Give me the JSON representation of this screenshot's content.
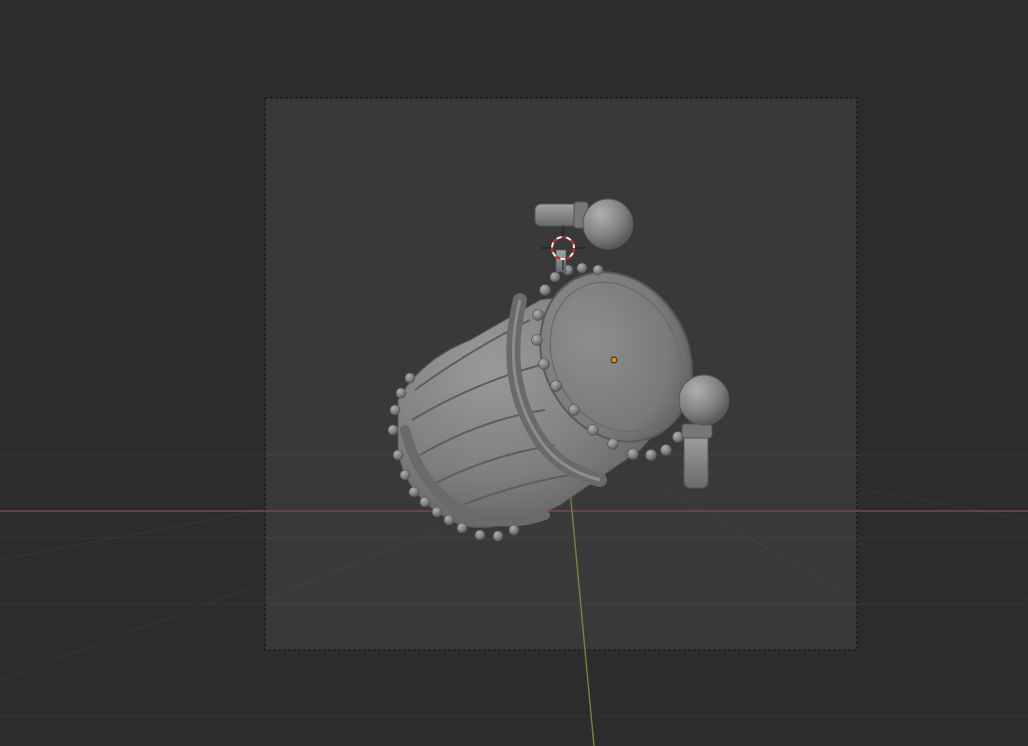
{
  "viewport": {
    "background_color": "#2c2c2c",
    "camera_frame_fill": "#393939",
    "camera_frame_border": "#101010",
    "grid_line_color": "#3a3a3a",
    "x_axis_color": "#8c4a52",
    "y_axis_color": "#6f8a3a",
    "cursor_color_primary": "#c81e1e",
    "cursor_color_secondary": "#f0f0f0",
    "origin_dot_color": "#e08a1e",
    "model_color": "#808080",
    "model_dark_color": "#5f5f5f",
    "model_light_color": "#9a9a9a",
    "object": "barrel-with-taps",
    "icons": [
      "3d-cursor-icon",
      "object-origin-icon"
    ]
  }
}
